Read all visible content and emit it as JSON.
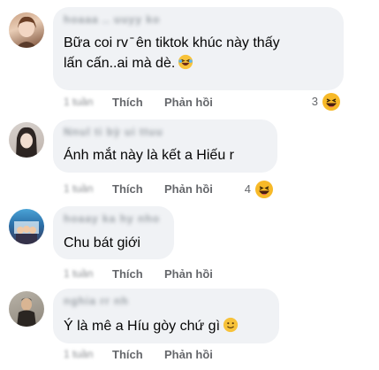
{
  "labels": {
    "like": "Thích",
    "reply": "Phản hồi"
  },
  "comments": [
    {
      "name": "hoaaa .. uuyy ko",
      "text": "Bữa coi rv  ̄ ên tiktok khúc này thấy\nlấn cấn..ai mà dè.",
      "time": "1 tuần",
      "reaction_count": "3"
    },
    {
      "name": "Nnul ti bỳ   ui ttuu",
      "text": "Ánh mắt này là kết a Hiếu r",
      "time": "1 tuần",
      "reaction_count": "4"
    },
    {
      "name": "hoaay ka  hy  nho",
      "text": "Chu bát giới",
      "time": "1 tuần",
      "reaction_count": ""
    },
    {
      "name": "nghia  rr  nh",
      "text": "Ý là mê a Híu gòy chứ gì",
      "time": "1 tuần",
      "reaction_count": ""
    }
  ]
}
